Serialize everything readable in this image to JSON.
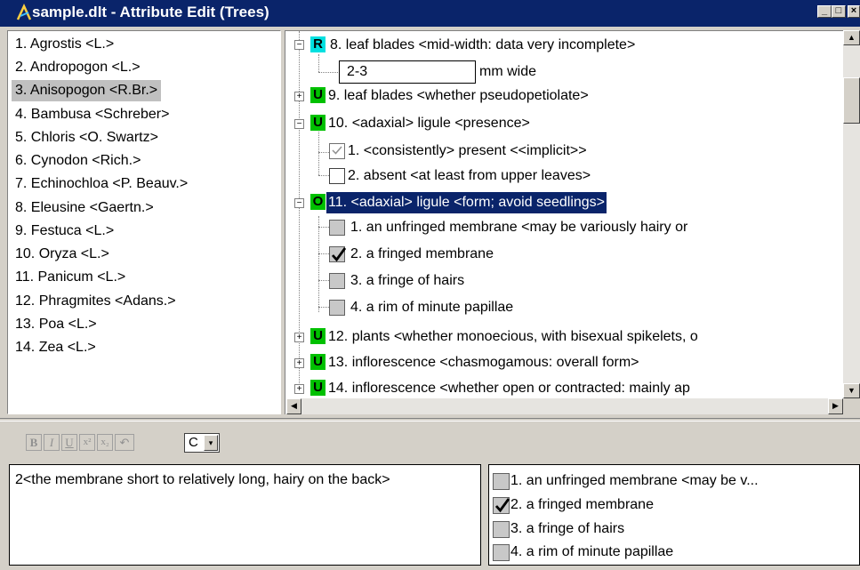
{
  "window": {
    "title": "sample.dlt - Attribute Edit (Trees)",
    "min_glyph": "_",
    "max_glyph": "□",
    "close_glyph": "×"
  },
  "taxa": [
    {
      "label": "1. Agrostis <L.>",
      "selected": false
    },
    {
      "label": "2. Andropogon <L.>",
      "selected": false
    },
    {
      "label": "3. Anisopogon <R.Br.>",
      "selected": true
    },
    {
      "label": "4. Bambusa <Schreber>",
      "selected": false
    },
    {
      "label": "5. Chloris <O. Swartz>",
      "selected": false
    },
    {
      "label": "6. Cynodon <Rich.>",
      "selected": false
    },
    {
      "label": "7. Echinochloa <P. Beauv.>",
      "selected": false
    },
    {
      "label": "8. Eleusine <Gaertn.>",
      "selected": false
    },
    {
      "label": "9. Festuca <L.>",
      "selected": false
    },
    {
      "label": "10. Oryza <L.>",
      "selected": false
    },
    {
      "label": "11. Panicum <L.>",
      "selected": false
    },
    {
      "label": "12. Phragmites <Adans.>",
      "selected": false
    },
    {
      "label": "13. Poa <L.>",
      "selected": false
    },
    {
      "label": "14. Zea <L.>",
      "selected": false
    }
  ],
  "tree": {
    "char8": {
      "expander": "−",
      "badge": "R",
      "label": "8. leaf blades <mid-width: data very incomplete>",
      "value": "2-3",
      "unit": "mm wide"
    },
    "char9": {
      "expander": "+",
      "badge": "U",
      "label": "9. leaf blades <whether pseudopetiolate>"
    },
    "char10": {
      "expander": "−",
      "badge": "U",
      "label": "10. <adaxial> ligule <presence>",
      "states": [
        {
          "label": "1. <consistently> present <<implicit>>",
          "checked": "implicit"
        },
        {
          "label": "2. absent <at least from upper leaves>",
          "checked": "none"
        }
      ]
    },
    "char11": {
      "expander": "−",
      "badge": "O",
      "label": "11. <adaxial> ligule <form; avoid seedlings>",
      "states": [
        {
          "label": "1. an unfringed membrane <may be variously hairy or",
          "checked": "none"
        },
        {
          "label": "2. a fringed membrane",
          "checked": "checked"
        },
        {
          "label": "3. a fringe of hairs",
          "checked": "none"
        },
        {
          "label": "4. a rim of minute papillae",
          "checked": "none"
        }
      ]
    },
    "char12": {
      "expander": "+",
      "badge": "U",
      "label": "12. plants <whether monoecious, with bisexual spikelets, o"
    },
    "char13": {
      "expander": "+",
      "badge": "U",
      "label": "13. inflorescence <chasmogamous: overall form>"
    },
    "char14": {
      "expander": "+",
      "badge": "U",
      "label": "14. inflorescence <whether open or contracted: mainly ap"
    }
  },
  "toolbar": {
    "bold": "B",
    "italic": "I",
    "underline": "U",
    "superscript": "x²",
    "subscript": "x₂",
    "undo": "↶",
    "combo_value": "C",
    "combo_arrow": "▾"
  },
  "comment": {
    "text": "2<the membrane short to relatively long, hairy on the back>"
  },
  "state_list": [
    {
      "label": "1. an unfringed membrane <may be v...",
      "checked": false
    },
    {
      "label": "2. a fringed membrane",
      "checked": true
    },
    {
      "label": "3. a fringe of hairs",
      "checked": false
    },
    {
      "label": "4. a rim of minute papillae",
      "checked": false
    }
  ],
  "scroll": {
    "up": "▲",
    "down": "▼",
    "left": "◀",
    "right": "▶"
  },
  "colors": {
    "titlebar": "#0a246a",
    "badge_R": "#00e0e0",
    "badge_U": "#00c000",
    "selection": "#0a246a"
  }
}
